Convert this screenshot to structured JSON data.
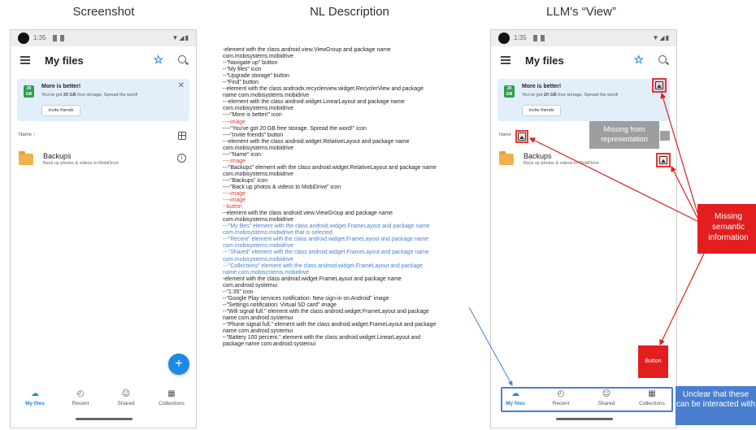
{
  "titles": {
    "screenshot": "Screenshot",
    "description": "NL Description",
    "view": "LLM's “View”"
  },
  "phone": {
    "status_time": "1:35",
    "status_icons": "▼◢▮",
    "app_title": "My files",
    "upgrade_icon": "ribbon-icon",
    "promo": {
      "badge": "20 GB",
      "title": "More is better!",
      "text_pre": "You've got ",
      "text_bold": "20 GB",
      "text_post": " free storage. Spread the word!",
      "button": "Invite friends",
      "close": "✕"
    },
    "sort_label": "Name ↑",
    "file": {
      "name": "Backups",
      "desc": "Back up photos & videos to MobiDrive"
    },
    "fab": "+",
    "nav": [
      {
        "label": "My files",
        "icon": "☁"
      },
      {
        "label": "Recent",
        "icon": "◴"
      },
      {
        "label": "Shared",
        "icon": "☺"
      },
      {
        "label": "Collections",
        "icon": "▦"
      }
    ],
    "info_icon": "i"
  },
  "description_lines": [
    {
      "text": "-element with the class android.view.ViewGroup and package name",
      "color": "black"
    },
    {
      "text": "com.mobisystems.mobidrive",
      "color": "black"
    },
    {
      "text": "--\"Navigate up\" button",
      "color": "black"
    },
    {
      "text": "--\"My files\" icon",
      "color": "black"
    },
    {
      "text": "--\"Upgrade storage\" button",
      "color": "black"
    },
    {
      "text": "--\"Find\" button",
      "color": "black"
    },
    {
      "text": "--element with the class androidx.recyclerview.widget.RecyclerView and package",
      "color": "black"
    },
    {
      "text": "name com.mobisystems.mobidrive",
      "color": "black"
    },
    {
      "text": "---element with the class android.widget.LinearLayout and package name",
      "color": "black"
    },
    {
      "text": "com.mobisystems.mobidrive",
      "color": "black"
    },
    {
      "text": "----\"More is better!\" icon",
      "color": "black"
    },
    {
      "text": "----image",
      "color": "red"
    },
    {
      "text": "----\"You've got 20 GB free storage. Spread the word!\" icon",
      "color": "black"
    },
    {
      "text": "----\"Invite friends\" button",
      "color": "black"
    },
    {
      "text": "---element with the class android.widget.RelativeLayout and package name",
      "color": "black"
    },
    {
      "text": "com.mobisystems.mobidrive",
      "color": "black"
    },
    {
      "text": "----\"Name\" icon",
      "color": "black"
    },
    {
      "text": "----image",
      "color": "red"
    },
    {
      "text": "---\"Backups\" element with the class android.widget.RelativeLayout and package name",
      "color": "black"
    },
    {
      "text": "com.mobisystems.mobidrive",
      "color": "black"
    },
    {
      "text": "----\"Backups\" icon",
      "color": "black"
    },
    {
      "text": "----\"Back up photos & videos to MobiDrive\" icon",
      "color": "black"
    },
    {
      "text": "----image",
      "color": "red"
    },
    {
      "text": "----image",
      "color": "red"
    },
    {
      "text": "--button",
      "color": "red"
    },
    {
      "text": "--element with the class android.view.ViewGroup and package name",
      "color": "black"
    },
    {
      "text": "com.mobisystems.mobidrive",
      "color": "black"
    },
    {
      "text": "---\"My files\" element with the class android.widget.FrameLayout and package name",
      "color": "blue"
    },
    {
      "text": "com.mobisystems.mobidrive that is selected",
      "color": "blue"
    },
    {
      "text": "---\"Recent\" element with the class android.widget.FrameLayout and package name",
      "color": "blue"
    },
    {
      "text": "com.mobisystems.mobidrive",
      "color": "blue"
    },
    {
      "text": "---\"Shared\" element with the class android.widget.FrameLayout and package name",
      "color": "blue"
    },
    {
      "text": "com.mobisystems.mobidrive",
      "color": "blue"
    },
    {
      "text": "---\"Collections\" element with the class android.widget.FrameLayout and package",
      "color": "blue"
    },
    {
      "text": "name com.mobisystems.mobidrive",
      "color": "blue"
    },
    {
      "text": "-element with the class android.widget.FrameLayout and package name",
      "color": "black"
    },
    {
      "text": "com.android.systemui",
      "color": "black"
    },
    {
      "text": "--\"1:35\" icon",
      "color": "black"
    },
    {
      "text": "--\"Google Play services notification: New sign-in on Android\" image",
      "color": "black"
    },
    {
      "text": "--\"Settings notification: Virtual SD card\" image",
      "color": "black"
    },
    {
      "text": "--\"Wifi signal full.\" element with the class android.widget.FrameLayout and package",
      "color": "black"
    },
    {
      "text": "name com.android.systemui",
      "color": "black"
    },
    {
      "text": "--\"Phone signal full.\" element with the class android.widget.FrameLayout and package",
      "color": "black"
    },
    {
      "text": "name com.android.systemui",
      "color": "black"
    },
    {
      "text": "--\"Battery 100 percent.\" element with the class android.widget.LinearLayout and",
      "color": "black"
    },
    {
      "text": "package name com.android.systemui",
      "color": "black"
    }
  ],
  "annotations": {
    "missing_representation": "Missing from representation",
    "missing_semantic": "Missing semantic information",
    "button": "Button",
    "unclear": "Unclear that these can be interacted with"
  },
  "colors": {
    "accent_blue": "#1e88e5",
    "annotation_red": "#e31e1e",
    "annotation_blue": "#4a7fd0",
    "promo_bg": "#e3eefb",
    "folder": "#f0b14a"
  }
}
